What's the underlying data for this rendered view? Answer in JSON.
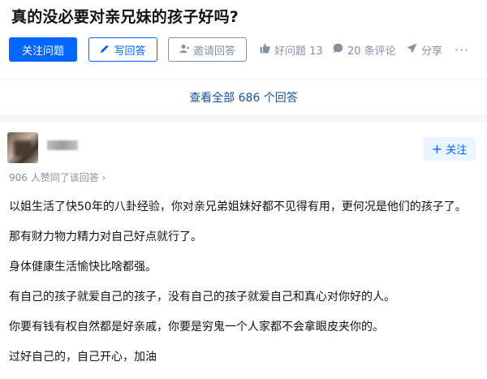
{
  "question": {
    "title": "真的没必要对亲兄妹的孩子好吗?",
    "follow_label": "关注问题",
    "write_label": "写回答",
    "invite_label": "邀请回答",
    "good_question_label": "好问题 13",
    "comments_label": "20 条评论",
    "share_label": "分享",
    "more_label": "···"
  },
  "view_all_label": "查看全部 686 个回答",
  "answer": {
    "follow_label": "关注",
    "votes_label": "906 人赞同了该回答 ›",
    "paragraphs": [
      "以姐生活了快50年的八卦经验，你对亲兄弟姐妹好都不见得有用，更何况是他们的孩子了。",
      "那有财力物力精力对自己好点就行了。",
      "身体健康生活愉快比啥都强。",
      "有自己的孩子就爱自己的孩子，没有自己的孩子就爱自己和真心对你好的人。",
      "你要有钱有权自然都是好亲戚，你要是穷鬼一个人家都不会拿眼皮夹你的。",
      "过好自己的，自己开心，加油"
    ]
  },
  "icons": {
    "pencil": "pencil-icon",
    "invite": "person-icon",
    "like": "thumb-up-icon",
    "comment": "comment-icon",
    "share": "paper-plane-icon",
    "plus": "plus-icon"
  },
  "colors": {
    "accent": "#0066ff",
    "link": "#175199",
    "muted": "#8590a6",
    "background": "#f6f6f6"
  }
}
